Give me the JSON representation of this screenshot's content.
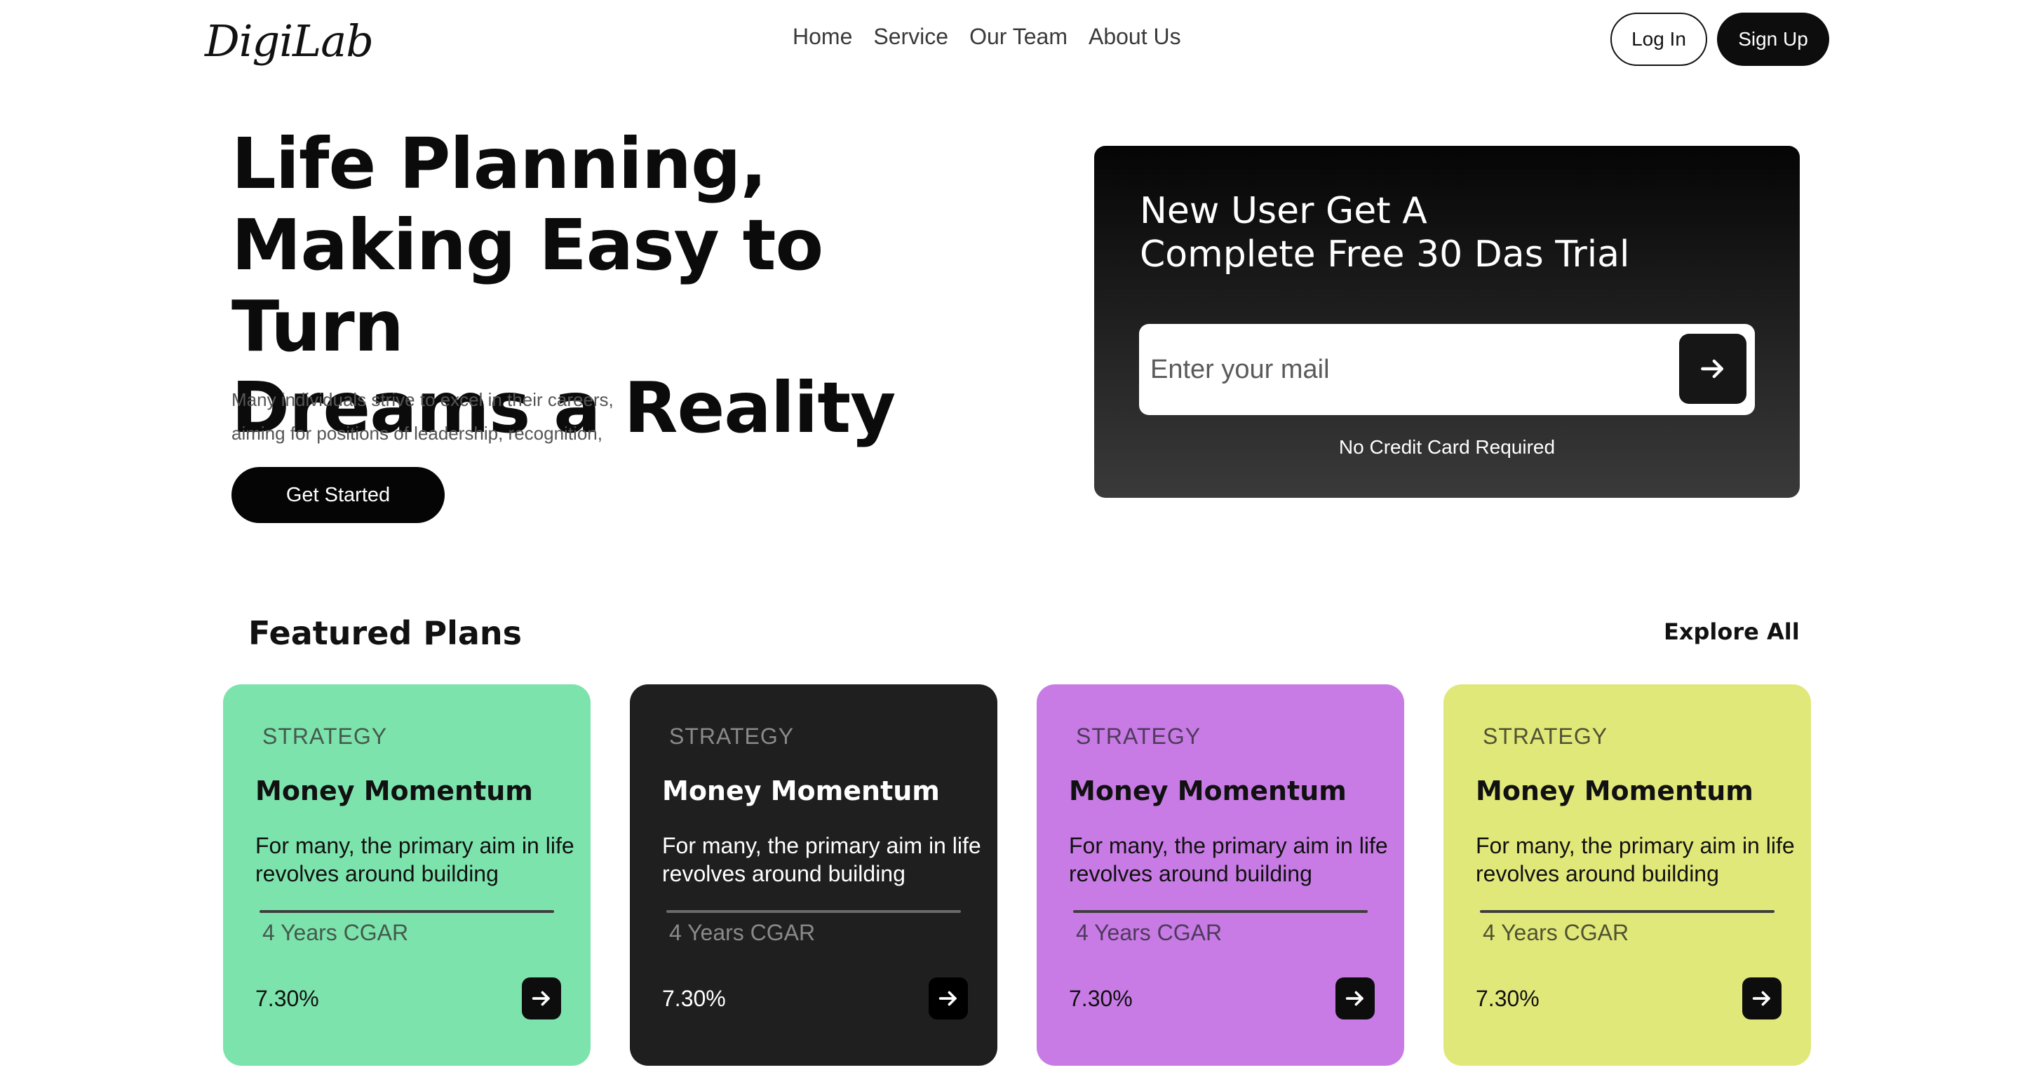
{
  "header": {
    "logo": "DigiLab",
    "nav": [
      "Home",
      "Service",
      "Our Team",
      "About Us"
    ],
    "login_label": "Log In",
    "signup_label": "Sign Up"
  },
  "hero": {
    "title_lines": [
      "Life Planning,",
      "Making Easy to Turn",
      "Dreams a Reality"
    ],
    "description_lines": [
      "Many individuals strive to excel in their careers,",
      "aiming for positions of leadership, recognition,"
    ],
    "cta_label": "Get Started"
  },
  "trial": {
    "title_lines": [
      "New User Get A",
      "Complete Free 30 Das Trial"
    ],
    "email_placeholder": "Enter your mail",
    "submit_icon": "arrow-right-icon",
    "note": "No Credit Card Required"
  },
  "featured": {
    "title": "Featured Plans",
    "explore_label": "Explore All",
    "cards": [
      {
        "label": "STRATEGY",
        "title": "Money Momentum",
        "description": "For many, the primary aim in life revolves around building",
        "cagr": "4 Years CGAR",
        "rate": "7.30%",
        "color": "#7de3ad"
      },
      {
        "label": "STRATEGY",
        "title": "Money Momentum",
        "description": "For many, the primary aim in life revolves around building",
        "cagr": "4 Years CGAR",
        "rate": "7.30%",
        "color": "#1f1f1f"
      },
      {
        "label": "STRATEGY",
        "title": "Money Momentum",
        "description": "For many, the primary aim in life revolves around building",
        "cagr": "4 Years CGAR",
        "rate": "7.30%",
        "color": "#c87be5"
      },
      {
        "label": "STRATEGY",
        "title": "Money Momentum",
        "description": "For many, the primary aim in life revolves around building",
        "cagr": "4 Years CGAR",
        "rate": "7.30%",
        "color": "#e1e87a"
      }
    ]
  }
}
